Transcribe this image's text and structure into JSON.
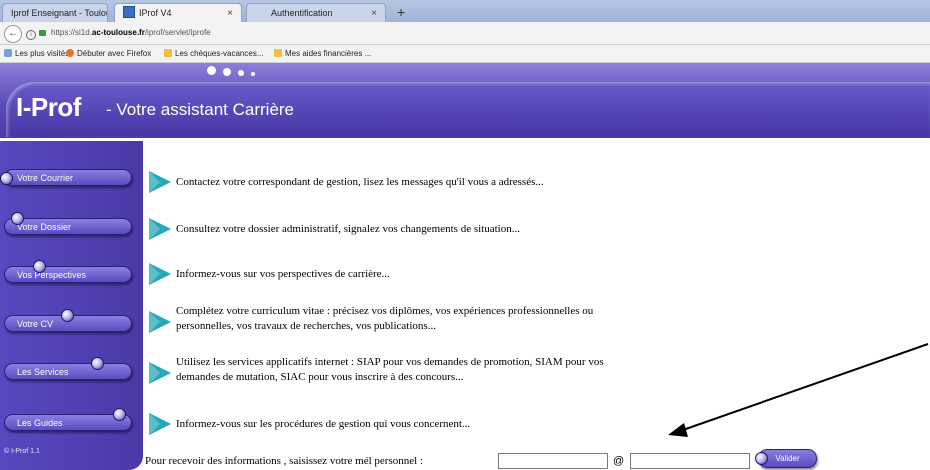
{
  "browser": {
    "tabs": [
      {
        "label": "Iprof Enseignant - Toulouse"
      },
      {
        "label": "IProf V4"
      },
      {
        "label": "Authentification"
      }
    ],
    "url_prefix": "https://si1d.",
    "url_domain": "ac-toulouse.fr",
    "url_path": "/iprof/servlet/iprofe",
    "bookmarks": [
      {
        "label": "Les plus visités"
      },
      {
        "label": "Débuter avec Firefox"
      },
      {
        "label": "Les chèques-vacances..."
      },
      {
        "label": "Mes aides financières ..."
      }
    ]
  },
  "header": {
    "logo": "I-Prof",
    "subtitle": "- Votre assistant Carrière"
  },
  "sidebar": {
    "items": [
      {
        "label": "Votre Courrier"
      },
      {
        "label": "Votre Dossier"
      },
      {
        "label": "Vos Perspectives"
      },
      {
        "label": "Votre CV"
      },
      {
        "label": "Les Services"
      },
      {
        "label": "Les Guides"
      }
    ],
    "footer": "© I-Prof  1.1"
  },
  "main": {
    "rows": [
      {
        "text": "Contactez votre correspondant de gestion, lisez les messages qu'il vous a adressés..."
      },
      {
        "text": "Consultez votre dossier administratif, signalez vos changements de situation..."
      },
      {
        "text": "Informez-vous sur vos perspectives de carrière..."
      },
      {
        "text": "Complétez votre curriculum vitae : précisez vos diplômes, vos expériences professionnelles ou personnelles, vos travaux de recherches, vos publications..."
      },
      {
        "text": "Utilisez les services applicatifs internet : SIAP pour vos demandes de promotion, SIAM pour vos demandes de mutation, SIAC pour vous inscrire à des concours..."
      },
      {
        "text": "Informez-vous sur les procédures de gestion qui vous concernent..."
      }
    ],
    "email": {
      "prompt": "Pour recevoir des informations , saisissez votre mél personnel :",
      "user_value": "",
      "at": "@",
      "domain_value": "",
      "validate_label": "Valider"
    }
  },
  "colors": {
    "brand_purple": "#4b3ba8",
    "arrow_teal": "#27a8b8"
  }
}
